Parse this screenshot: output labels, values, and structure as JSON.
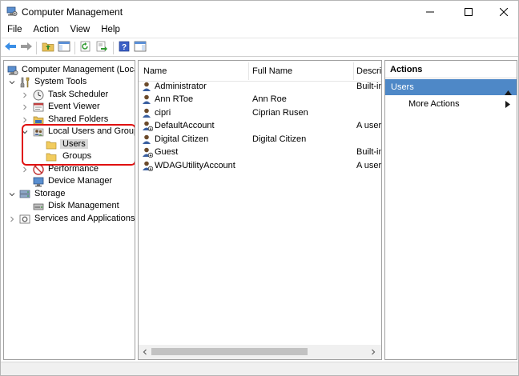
{
  "window": {
    "title": "Computer Management"
  },
  "menu": [
    "File",
    "Action",
    "View",
    "Help"
  ],
  "toolbar": {
    "buttons": [
      "back-arrow-icon",
      "forward-arrow-icon",
      "up-folder-icon",
      "show-hide-tree-icon",
      "refresh-icon",
      "export-list-icon",
      "help-icon",
      "properties-pane-icon"
    ]
  },
  "tree": {
    "root": "Computer Management (Local)",
    "system_tools": "System Tools",
    "task_scheduler": "Task Scheduler",
    "event_viewer": "Event Viewer",
    "shared_folders": "Shared Folders",
    "local_users_groups": "Local Users and Groups",
    "users": "Users",
    "groups": "Groups",
    "performance": "Performance",
    "device_manager": "Device Manager",
    "storage": "Storage",
    "disk_management": "Disk Management",
    "services_applications": "Services and Applications"
  },
  "list": {
    "columns": {
      "name": "Name",
      "full_name": "Full Name",
      "description": "Descrip"
    },
    "rows": [
      {
        "name": "Administrator",
        "full_name": "",
        "description": "Built-in"
      },
      {
        "name": "Ann RToe",
        "full_name": "Ann Roe",
        "description": ""
      },
      {
        "name": "cipri",
        "full_name": "Ciprian Rusen",
        "description": ""
      },
      {
        "name": "DefaultAccount",
        "full_name": "",
        "description": "A user a"
      },
      {
        "name": "Digital Citizen",
        "full_name": "Digital Citizen",
        "description": ""
      },
      {
        "name": "Guest",
        "full_name": "",
        "description": "Built-in"
      },
      {
        "name": "WDAGUtilityAccount",
        "full_name": "",
        "description": "A user a"
      }
    ]
  },
  "actions": {
    "header": "Actions",
    "section": "Users",
    "more_actions": "More Actions"
  },
  "colors": {
    "accent": "#4e88c7",
    "highlight": "#e01010",
    "selection": "#d9d9d9"
  }
}
